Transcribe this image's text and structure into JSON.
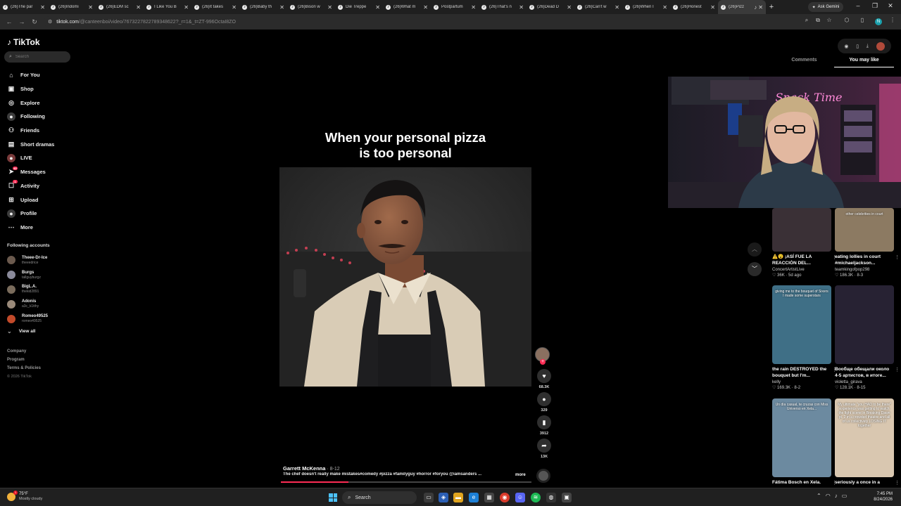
{
  "browser": {
    "tabs": [
      {
        "label": "(26)The par",
        "icon": "tiktok-icon"
      },
      {
        "label": "(26)Indomi",
        "icon": "tiktok-icon"
      },
      {
        "label": "(26)EDM sc",
        "icon": "tiktok-icon"
      },
      {
        "label": "I Like You B",
        "icon": "tiktok-icon"
      },
      {
        "label": "(26)It takes",
        "icon": "tiktok-icon"
      },
      {
        "label": "(26)Baby th",
        "icon": "tiktok-icon"
      },
      {
        "label": "(26)Bison w",
        "icon": "tiktok-icon"
      },
      {
        "label": "Die Treppe",
        "icon": "tiktok-icon"
      },
      {
        "label": "(26)What m",
        "icon": "tiktok-icon"
      },
      {
        "label": "Postpartum",
        "icon": "tiktok-icon"
      },
      {
        "label": "(26)That's n",
        "icon": "tiktok-icon"
      },
      {
        "label": "(26)Dead D",
        "icon": "tiktok-icon"
      },
      {
        "label": "(26)Can't w",
        "icon": "tiktok-icon"
      },
      {
        "label": "(26)When I",
        "icon": "tiktok-icon"
      },
      {
        "label": "(26)Honest",
        "icon": "tiktok-icon"
      },
      {
        "label": "(26)Pizz",
        "icon": "tiktok-icon",
        "active": true
      }
    ],
    "gemini_label": "Ask Gemini",
    "url_host": "tiktok.com",
    "url_path": "/@canteenboi/video/7673227822789348622?_r=1&_t=ZT-996OctaI8ZO"
  },
  "sidebar": {
    "logo_text": "TikTok",
    "search_placeholder": "Search",
    "nav": [
      {
        "label": "For You",
        "icon": "home-icon",
        "glyph": "⌂"
      },
      {
        "label": "Shop",
        "icon": "shop-bag-icon",
        "glyph": "▣"
      },
      {
        "label": "Explore",
        "icon": "compass-icon",
        "glyph": "◎"
      },
      {
        "label": "Following",
        "icon": "following-avatar-icon",
        "glyph": "●"
      },
      {
        "label": "Friends",
        "icon": "friends-icon",
        "glyph": "⚇"
      },
      {
        "label": "Short dramas",
        "icon": "film-icon",
        "glyph": "▤"
      },
      {
        "label": "LIVE",
        "icon": "live-avatar-icon",
        "glyph": "●"
      },
      {
        "label": "Messages",
        "icon": "messages-icon",
        "glyph": "➤",
        "badge": "40"
      },
      {
        "label": "Activity",
        "icon": "inbox-icon",
        "glyph": "☐",
        "badge": "1"
      },
      {
        "label": "Upload",
        "icon": "upload-icon",
        "glyph": "⊞"
      },
      {
        "label": "Profile",
        "icon": "profile-avatar-icon",
        "glyph": "●"
      },
      {
        "label": "More",
        "icon": "more-icon",
        "glyph": "⋯"
      }
    ],
    "following_title": "Following accounts",
    "following": [
      {
        "name": "Theee-Dr-Ice",
        "handle": "theeedrice",
        "color": "#6b5a4e"
      },
      {
        "name": "Burgs",
        "handle": "tallguyburgz",
        "color": "#8a8a9a"
      },
      {
        "name": "BigL.A.",
        "handle": "thekid2891",
        "color": "#7a6c5c"
      },
      {
        "name": "Adonis",
        "handle": "a3c_k1tthy",
        "color": "#9a8a7a"
      },
      {
        "name": "Romeo49525",
        "handle": "romeo49525",
        "color": "#c24a2a"
      }
    ],
    "view_all": "View all",
    "footer": [
      "Company",
      "Program",
      "Terms & Policies"
    ],
    "copyright": "© 2026 TikTok"
  },
  "video": {
    "caption_line1": "When your personal pizza",
    "caption_line2": "is too personal",
    "author": "Garrett McKenna",
    "date": " · 8-12",
    "description": "The chef doesn't really make mistakes#comedy #pizza #familyguy #horror #foryou @iamsanders ...",
    "more": "more",
    "progress": 0.27,
    "actions": [
      {
        "name": "like",
        "icon": "heart-icon",
        "glyph": "♥",
        "count": "68.3K"
      },
      {
        "name": "comment",
        "icon": "comment-icon",
        "glyph": "●",
        "count": "329"
      },
      {
        "name": "save",
        "icon": "bookmark-icon",
        "glyph": "▮",
        "count": "3912"
      },
      {
        "name": "share",
        "icon": "share-icon",
        "glyph": "➦",
        "count": "13K"
      }
    ]
  },
  "right_panel": {
    "tabs": [
      "Comments",
      "You may like"
    ],
    "active_tab": 1,
    "webcam_sign": "Snack Time",
    "recommendations": [
      {
        "title": "⚠️😮 ¡ASÍ FUE LA REACCIÓN DEL...",
        "author": "ConcertArtistLive",
        "stats": "♡ 36K · 5d ago",
        "thumb_text": "",
        "bg": "#3a3036"
      },
      {
        "title": "eating lollies in court #michaeljackson...",
        "author": "teamkingofpop298",
        "stats": "♡ 186.3K · 8-3",
        "thumb_text": "other celebrities in court",
        "bg": "#8c7a62"
      },
      {
        "title": "the rain DESTROYED the bouquet but I'm...",
        "author": "kelly",
        "stats": "♡ 169.3K · 8-2",
        "thumb_text": "giving me to the bouquet of Sixers I made some superstars",
        "bg": "#3f6f86"
      },
      {
        "title": "Вообще обещали около 4-5 артистов, в итоге...",
        "author": "violetta_girava",
        "stats": "♡ 128.1K · 8-15",
        "thumb_text": "",
        "bg": "#272233"
      },
      {
        "title": "Fátima Bosch en Xela.",
        "author": "",
        "stats": "",
        "thumb_text": "Un día casual, te cruzas con Miss Universo en Xela...",
        "bg": "#6c8aa0"
      },
      {
        "title": "seriously a once in a",
        "author": "",
        "stats": "",
        "thumb_text": "My ultimate \"you HAD to be there\" experience was getting to watch the fight scene in Breaking Dawn pt. 2 in a crowded theatre and all of us collectively LOSING IT together",
        "bg": "#d9c7b0"
      }
    ]
  },
  "taskbar": {
    "temp": "75°F",
    "weather": "Mostly cloudy",
    "weather_badge": "1",
    "search_label": "Search",
    "time": "7:45 PM",
    "date": "8/24/2026"
  }
}
